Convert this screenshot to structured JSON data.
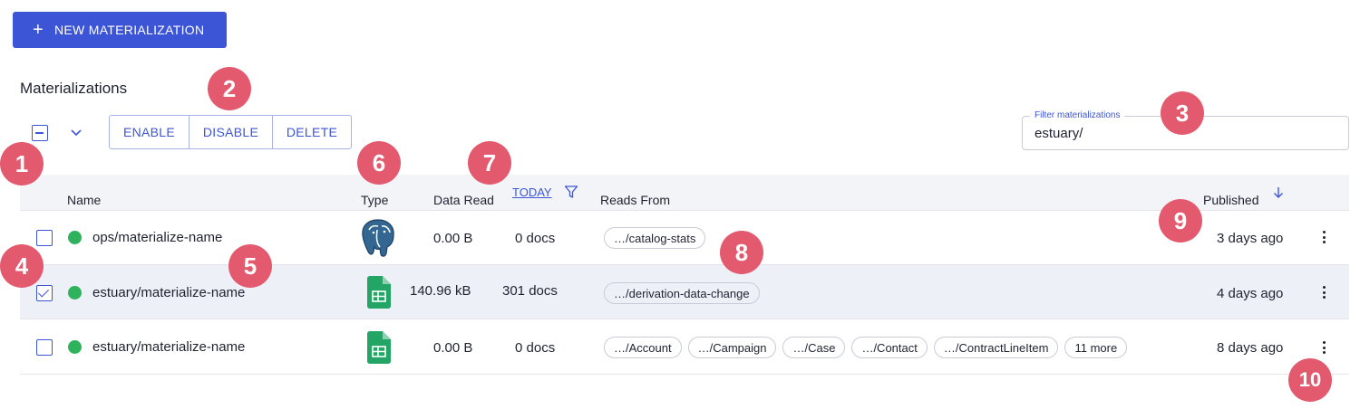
{
  "toolbar": {
    "new_button_label": "NEW MATERIALIZATION",
    "new_button_icon": "plus-icon"
  },
  "section_title": "Materializations",
  "actions": {
    "enable": "ENABLE",
    "disable": "DISABLE",
    "delete": "DELETE"
  },
  "filter": {
    "label": "Filter materializations",
    "value": "estuary/"
  },
  "columns": {
    "name": "Name",
    "type": "Type",
    "data_read": "Data Read",
    "today": "TODAY",
    "reads_from": "Reads From",
    "published": "Published"
  },
  "rows": [
    {
      "name": "ops/materialize-name",
      "type_icon": "postgres-icon",
      "bytes": "0.00 B",
      "docs": "0 docs",
      "reads_from": [
        "…/catalog-stats"
      ],
      "published": "3 days ago",
      "checked": false,
      "status_color": "#2eb35c"
    },
    {
      "name": "estuary/materialize-name",
      "type_icon": "google-sheets-icon",
      "bytes": "140.96 kB",
      "docs": "301 docs",
      "reads_from": [
        "…/derivation-data-change"
      ],
      "published": "4 days ago",
      "checked": true,
      "status_color": "#2eb35c"
    },
    {
      "name": "estuary/materialize-name",
      "type_icon": "google-sheets-icon",
      "bytes": "0.00 B",
      "docs": "0 docs",
      "reads_from": [
        "…/Account",
        "…/Campaign",
        "…/Case",
        "…/Contact",
        "…/ContractLineItem",
        "11 more"
      ],
      "published": "8 days ago",
      "checked": false,
      "status_color": "#2eb35c"
    }
  ],
  "annotations": [
    "1",
    "2",
    "3",
    "4",
    "5",
    "6",
    "7",
    "8",
    "9",
    "10"
  ],
  "colors": {
    "accent": "#3c55d6",
    "status_green": "#2eb35c",
    "annotation_badge": "#e35a6e",
    "selected_row": "#eef0f8"
  }
}
